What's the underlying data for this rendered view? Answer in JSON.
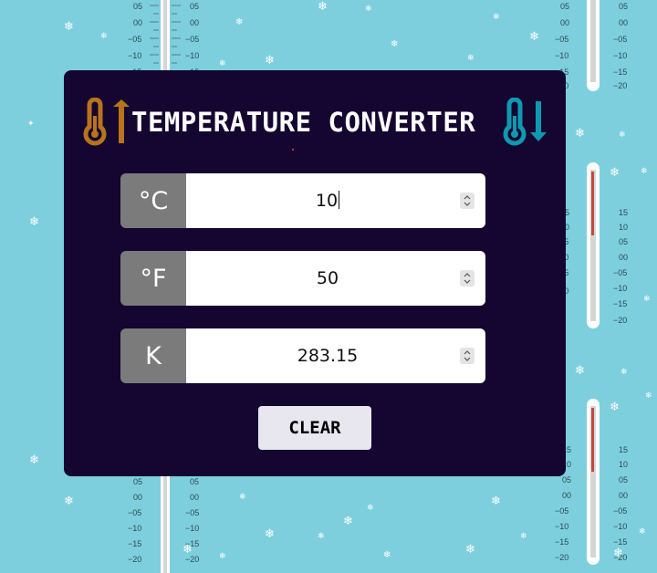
{
  "app": {
    "title": "TEMPERATURE CONVERTER"
  },
  "celsius": {
    "unit_label": "°C",
    "value": "10"
  },
  "fahrenheit": {
    "unit_label": "°F",
    "value": "50"
  },
  "kelvin": {
    "unit_label": "K",
    "value": "283.15"
  },
  "clear_button": {
    "label": "CLEAR"
  },
  "icons": {
    "left": "thermometer-up-icon",
    "right": "thermometer-down-icon",
    "spinner": "spinner-arrows-icon",
    "snowflake": "snowflake-icon"
  },
  "colors": {
    "background": "#7ecfdd",
    "card": "#140630",
    "unit_box": "#7b7b7b",
    "icon_warm": "#b8741d",
    "icon_cold": "#0e99b0",
    "button": "#e8e6ee"
  },
  "background_thermometer": {
    "scale_labels": [
      "05",
      "00",
      "−05",
      "−10",
      "−15",
      "−20"
    ],
    "upper_labels": [
      "15",
      "10",
      "05",
      "00",
      "−05",
      "−10",
      "−15",
      "−20"
    ]
  }
}
